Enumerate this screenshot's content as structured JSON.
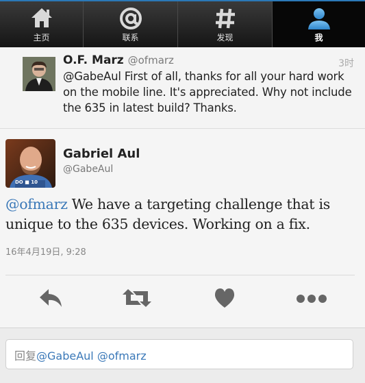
{
  "tabs": [
    {
      "label": "主页",
      "icon": "home-icon"
    },
    {
      "label": "联系",
      "icon": "at-icon"
    },
    {
      "label": "发现",
      "icon": "hashtag-icon"
    },
    {
      "label": "我",
      "icon": "person-icon"
    }
  ],
  "reply_to": {
    "name": "O.F. Marz",
    "handle": "@ofmarz",
    "time": "3时",
    "text": "@GabeAul First of all, thanks for all your hard work on the mobile line. It's appreciated. Why not include the 635 in latest build? Thanks."
  },
  "tweet": {
    "name": "Gabriel Aul",
    "handle": "@GabeAul",
    "mention": "@ofmarz",
    "text": " We have a targeting challenge that is unique to the 635 devices. Working on a fix.",
    "date": "16年4月19日, 9:28"
  },
  "avatar_badge": "DO ■ 10",
  "actions": [
    "reply-icon",
    "retweet-icon",
    "favorite-icon",
    "more-icon"
  ],
  "reply_box": {
    "prefix": "回复",
    "mentions": "@GabeAul @ofmarz"
  },
  "colors": {
    "accent": "#3a78b8",
    "tab_active_icon": "#4aa3e0"
  }
}
